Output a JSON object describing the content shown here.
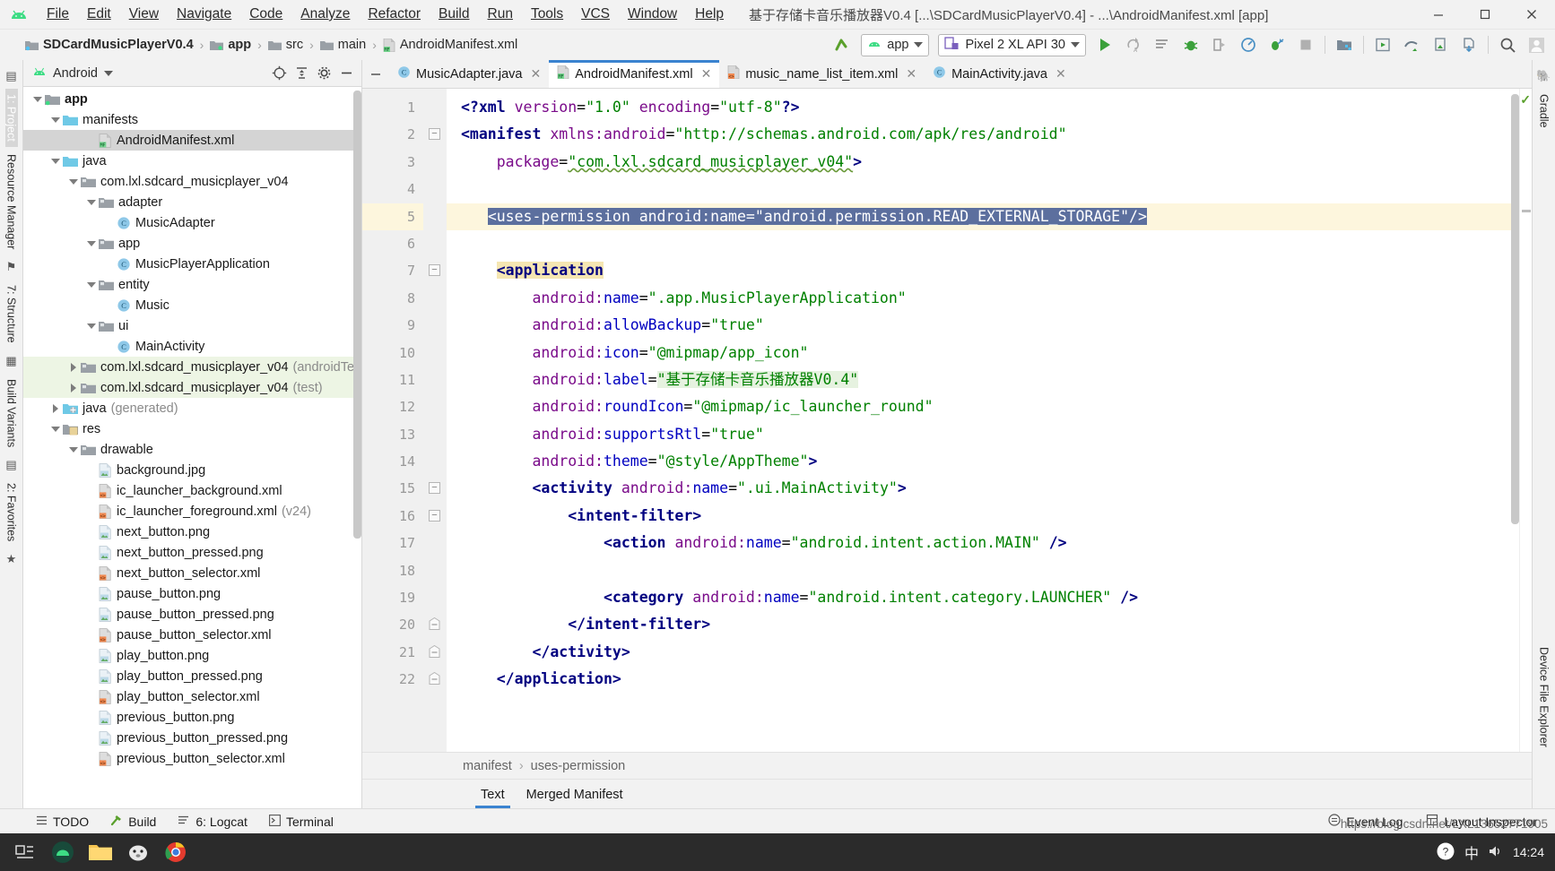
{
  "window": {
    "title": "基于存储卡音乐播放器V0.4 [...\\SDCardMusicPlayerV0.4] - ...\\AndroidManifest.xml [app]",
    "minimize": "—",
    "maximize": "▢",
    "close": "✕"
  },
  "menu": [
    {
      "label": "File",
      "mnemonic": "F"
    },
    {
      "label": "Edit",
      "mnemonic": "E"
    },
    {
      "label": "View",
      "mnemonic": "V"
    },
    {
      "label": "Navigate",
      "mnemonic": "N"
    },
    {
      "label": "Code",
      "mnemonic": "C"
    },
    {
      "label": "Analyze",
      "mnemonic": "z"
    },
    {
      "label": "Refactor",
      "mnemonic": "R"
    },
    {
      "label": "Build",
      "mnemonic": "B"
    },
    {
      "label": "Run",
      "mnemonic": "u"
    },
    {
      "label": "Tools",
      "mnemonic": "T"
    },
    {
      "label": "VCS",
      "mnemonic": "S"
    },
    {
      "label": "Window",
      "mnemonic": "W"
    },
    {
      "label": "Help",
      "mnemonic": "H"
    }
  ],
  "breadcrumb": [
    {
      "label": "SDCardMusicPlayerV0.4",
      "icon": "module-icon",
      "bold": true
    },
    {
      "label": "app",
      "icon": "module-icon",
      "bold": true
    },
    {
      "label": "src",
      "icon": "folder-icon",
      "bold": false
    },
    {
      "label": "main",
      "icon": "folder-icon",
      "bold": false
    },
    {
      "label": "AndroidManifest.xml",
      "icon": "manifest-icon",
      "bold": false
    }
  ],
  "toolbar": {
    "module_selector": "app",
    "device_selector": "Pixel 2 XL API 30",
    "icons": [
      "sync-project-icon",
      "run-icon",
      "apply-changes-icon",
      "apply-code-changes-icon",
      "debug-icon",
      "attach-debugger-icon",
      "profiler-icon",
      "run-coverage-icon",
      "stop-icon",
      "sdk-manager-icon",
      "avd-manager-icon",
      "device-file-explorer-icon",
      "layout-inspector-icon",
      "gradle-sync-icon",
      "search-icon",
      "avatar-icon"
    ]
  },
  "left_rail": [
    {
      "label": "1: Project",
      "selected": true
    },
    {
      "label": "Resource Manager",
      "selected": false
    },
    {
      "label": "7: Structure",
      "selected": false
    },
    {
      "label": "Build Variants",
      "selected": false
    },
    {
      "label": "2: Favorites",
      "selected": false
    }
  ],
  "right_rail": [
    {
      "label": "Gradle"
    },
    {
      "label": "Device File Explorer"
    }
  ],
  "project_panel": {
    "title": "Android",
    "header_icons": [
      "locate-icon",
      "collapse-all-icon",
      "settings-gear-icon",
      "hide-icon"
    ],
    "tree": [
      {
        "label": "app",
        "indent": 0,
        "twisty": "down",
        "icon": "module-icon",
        "bold": true,
        "state": "none",
        "suffix": ""
      },
      {
        "label": "manifests",
        "indent": 1,
        "twisty": "down",
        "icon": "folder-blue-icon",
        "bold": false,
        "state": "none",
        "suffix": ""
      },
      {
        "label": "AndroidManifest.xml",
        "indent": 3,
        "twisty": "none",
        "icon": "manifest-icon",
        "bold": false,
        "state": "selected",
        "suffix": ""
      },
      {
        "label": "java",
        "indent": 1,
        "twisty": "down",
        "icon": "folder-blue-icon",
        "bold": false,
        "state": "none",
        "suffix": ""
      },
      {
        "label": "com.lxl.sdcard_musicplayer_v04",
        "indent": 2,
        "twisty": "down",
        "icon": "package-icon",
        "bold": false,
        "state": "none",
        "suffix": ""
      },
      {
        "label": "adapter",
        "indent": 3,
        "twisty": "down",
        "icon": "package-icon",
        "bold": false,
        "state": "none",
        "suffix": ""
      },
      {
        "label": "MusicAdapter",
        "indent": 4,
        "twisty": "none",
        "icon": "class-icon",
        "bold": false,
        "state": "none",
        "suffix": ""
      },
      {
        "label": "app",
        "indent": 3,
        "twisty": "down",
        "icon": "package-icon",
        "bold": false,
        "state": "none",
        "suffix": ""
      },
      {
        "label": "MusicPlayerApplication",
        "indent": 4,
        "twisty": "none",
        "icon": "class-icon",
        "bold": false,
        "state": "none",
        "suffix": ""
      },
      {
        "label": "entity",
        "indent": 3,
        "twisty": "down",
        "icon": "package-icon",
        "bold": false,
        "state": "none",
        "suffix": ""
      },
      {
        "label": "Music",
        "indent": 4,
        "twisty": "none",
        "icon": "class-icon",
        "bold": false,
        "state": "none",
        "suffix": ""
      },
      {
        "label": "ui",
        "indent": 3,
        "twisty": "down",
        "icon": "package-icon",
        "bold": false,
        "state": "none",
        "suffix": ""
      },
      {
        "label": "MainActivity",
        "indent": 4,
        "twisty": "none",
        "icon": "class-icon",
        "bold": false,
        "state": "none",
        "suffix": ""
      },
      {
        "label": "com.lxl.sdcard_musicplayer_v04",
        "indent": 2,
        "twisty": "right",
        "icon": "package-icon",
        "bold": false,
        "state": "green",
        "suffix": "(androidTes"
      },
      {
        "label": "com.lxl.sdcard_musicplayer_v04",
        "indent": 2,
        "twisty": "right",
        "icon": "package-icon",
        "bold": false,
        "state": "green",
        "suffix": "(test)"
      },
      {
        "label": "java",
        "indent": 1,
        "twisty": "right",
        "icon": "generated-icon",
        "bold": false,
        "state": "none",
        "suffix": "(generated)"
      },
      {
        "label": "res",
        "indent": 1,
        "twisty": "down",
        "icon": "res-icon",
        "bold": false,
        "state": "none",
        "suffix": ""
      },
      {
        "label": "drawable",
        "indent": 2,
        "twisty": "down",
        "icon": "package-icon",
        "bold": false,
        "state": "none",
        "suffix": ""
      },
      {
        "label": "background.jpg",
        "indent": 3,
        "twisty": "none",
        "icon": "image-file-icon",
        "bold": false,
        "state": "none",
        "suffix": ""
      },
      {
        "label": "ic_launcher_background.xml",
        "indent": 3,
        "twisty": "none",
        "icon": "xml-file-icon",
        "bold": false,
        "state": "none",
        "suffix": ""
      },
      {
        "label": "ic_launcher_foreground.xml",
        "indent": 3,
        "twisty": "none",
        "icon": "xml-file-icon",
        "bold": false,
        "state": "none",
        "suffix": "(v24)"
      },
      {
        "label": "next_button.png",
        "indent": 3,
        "twisty": "none",
        "icon": "image-file-icon",
        "bold": false,
        "state": "none",
        "suffix": ""
      },
      {
        "label": "next_button_pressed.png",
        "indent": 3,
        "twisty": "none",
        "icon": "image-file-icon",
        "bold": false,
        "state": "none",
        "suffix": ""
      },
      {
        "label": "next_button_selector.xml",
        "indent": 3,
        "twisty": "none",
        "icon": "xml-file-icon",
        "bold": false,
        "state": "none",
        "suffix": ""
      },
      {
        "label": "pause_button.png",
        "indent": 3,
        "twisty": "none",
        "icon": "image-file-icon",
        "bold": false,
        "state": "none",
        "suffix": ""
      },
      {
        "label": "pause_button_pressed.png",
        "indent": 3,
        "twisty": "none",
        "icon": "image-file-icon",
        "bold": false,
        "state": "none",
        "suffix": ""
      },
      {
        "label": "pause_button_selector.xml",
        "indent": 3,
        "twisty": "none",
        "icon": "xml-file-icon",
        "bold": false,
        "state": "none",
        "suffix": ""
      },
      {
        "label": "play_button.png",
        "indent": 3,
        "twisty": "none",
        "icon": "image-file-icon",
        "bold": false,
        "state": "none",
        "suffix": ""
      },
      {
        "label": "play_button_pressed.png",
        "indent": 3,
        "twisty": "none",
        "icon": "image-file-icon",
        "bold": false,
        "state": "none",
        "suffix": ""
      },
      {
        "label": "play_button_selector.xml",
        "indent": 3,
        "twisty": "none",
        "icon": "xml-file-icon",
        "bold": false,
        "state": "none",
        "suffix": ""
      },
      {
        "label": "previous_button.png",
        "indent": 3,
        "twisty": "none",
        "icon": "image-file-icon",
        "bold": false,
        "state": "none",
        "suffix": ""
      },
      {
        "label": "previous_button_pressed.png",
        "indent": 3,
        "twisty": "none",
        "icon": "image-file-icon",
        "bold": false,
        "state": "none",
        "suffix": ""
      },
      {
        "label": "previous_button_selector.xml",
        "indent": 3,
        "twisty": "none",
        "icon": "xml-file-icon",
        "bold": false,
        "state": "none",
        "suffix": ""
      }
    ]
  },
  "editor": {
    "tabs": [
      {
        "label": "MusicAdapter.java",
        "icon": "java-class-icon",
        "active": false
      },
      {
        "label": "AndroidManifest.xml",
        "icon": "manifest-icon",
        "active": true
      },
      {
        "label": "music_name_list_item.xml",
        "icon": "xml-file-icon",
        "active": false
      },
      {
        "label": "MainActivity.java",
        "icon": "java-class-icon",
        "active": false
      }
    ],
    "current_line": 5,
    "lines": [
      {
        "n": 1,
        "fold": "none"
      },
      {
        "n": 2,
        "fold": "open"
      },
      {
        "n": 3,
        "fold": "none"
      },
      {
        "n": 4,
        "fold": "none"
      },
      {
        "n": 5,
        "fold": "none"
      },
      {
        "n": 6,
        "fold": "none"
      },
      {
        "n": 7,
        "fold": "open"
      },
      {
        "n": 8,
        "fold": "none"
      },
      {
        "n": 9,
        "fold": "none"
      },
      {
        "n": 10,
        "fold": "none"
      },
      {
        "n": 11,
        "fold": "none"
      },
      {
        "n": 12,
        "fold": "none"
      },
      {
        "n": 13,
        "fold": "none"
      },
      {
        "n": 14,
        "fold": "none"
      },
      {
        "n": 15,
        "fold": "open"
      },
      {
        "n": 16,
        "fold": "open"
      },
      {
        "n": 17,
        "fold": "none"
      },
      {
        "n": 18,
        "fold": "none"
      },
      {
        "n": 19,
        "fold": "none"
      },
      {
        "n": 20,
        "fold": "close"
      },
      {
        "n": 21,
        "fold": "close"
      },
      {
        "n": 22,
        "fold": "close"
      }
    ],
    "source_text": [
      "<?xml version=\"1.0\" encoding=\"utf-8\"?>",
      "<manifest xmlns:android=\"http://schemas.android.com/apk/res/android\"",
      "    package=\"com.lxl.sdcard_musicplayer_v04\">",
      "",
      "    <uses-permission android:name=\"android.permission.READ_EXTERNAL_STORAGE\"/>",
      "",
      "    <application",
      "        android:name=\".app.MusicPlayerApplication\"",
      "        android:allowBackup=\"true\"",
      "        android:icon=\"@mipmap/app_icon\"",
      "        android:label=\"基于存储卡音乐播放器V0.4\"",
      "        android:roundIcon=\"@mipmap/ic_launcher_round\"",
      "        android:supportsRtl=\"true\"",
      "        android:theme=\"@style/AppTheme\">",
      "        <activity android:name=\".ui.MainActivity\">",
      "            <intent-filter>",
      "                <action android:name=\"android.intent.action.MAIN\" />",
      "",
      "                <category android:name=\"android.intent.category.LAUNCHER\" />",
      "            </intent-filter>",
      "        </activity>",
      "    </application>"
    ],
    "breadcrumb": [
      "manifest",
      "uses-permission"
    ],
    "design_tabs": [
      {
        "label": "Text",
        "active": true
      },
      {
        "label": "Merged Manifest",
        "active": false
      }
    ]
  },
  "statusbar": {
    "left": [
      {
        "label": "TODO",
        "icon": "todo-icon"
      },
      {
        "label": "Build",
        "icon": "build-hammer-icon"
      },
      {
        "label": "6: Logcat",
        "icon": "logcat-icon"
      },
      {
        "label": "Terminal",
        "icon": "terminal-icon"
      }
    ],
    "right": [
      {
        "label": "Event Log",
        "icon": "event-log-icon"
      },
      {
        "label": "Layout Inspector",
        "icon": "layout-inspector-icon"
      }
    ]
  },
  "taskbar": {
    "watermark": "https://blog.csdn.net/LXL13652771905",
    "clock_time": "14:24",
    "ime_label": "中",
    "apps": [
      "task-view-icon",
      "android-studio-icon",
      "file-explorer-icon",
      "app-icon",
      "chrome-icon"
    ]
  },
  "colors": {
    "accent": "#3a83d0",
    "selection": "#5c6f9e",
    "current_line": "#fdf6dd",
    "tag": "#000080",
    "attr": "#7a0b8a",
    "value": "#008000",
    "green_row": "#edf5e4"
  }
}
